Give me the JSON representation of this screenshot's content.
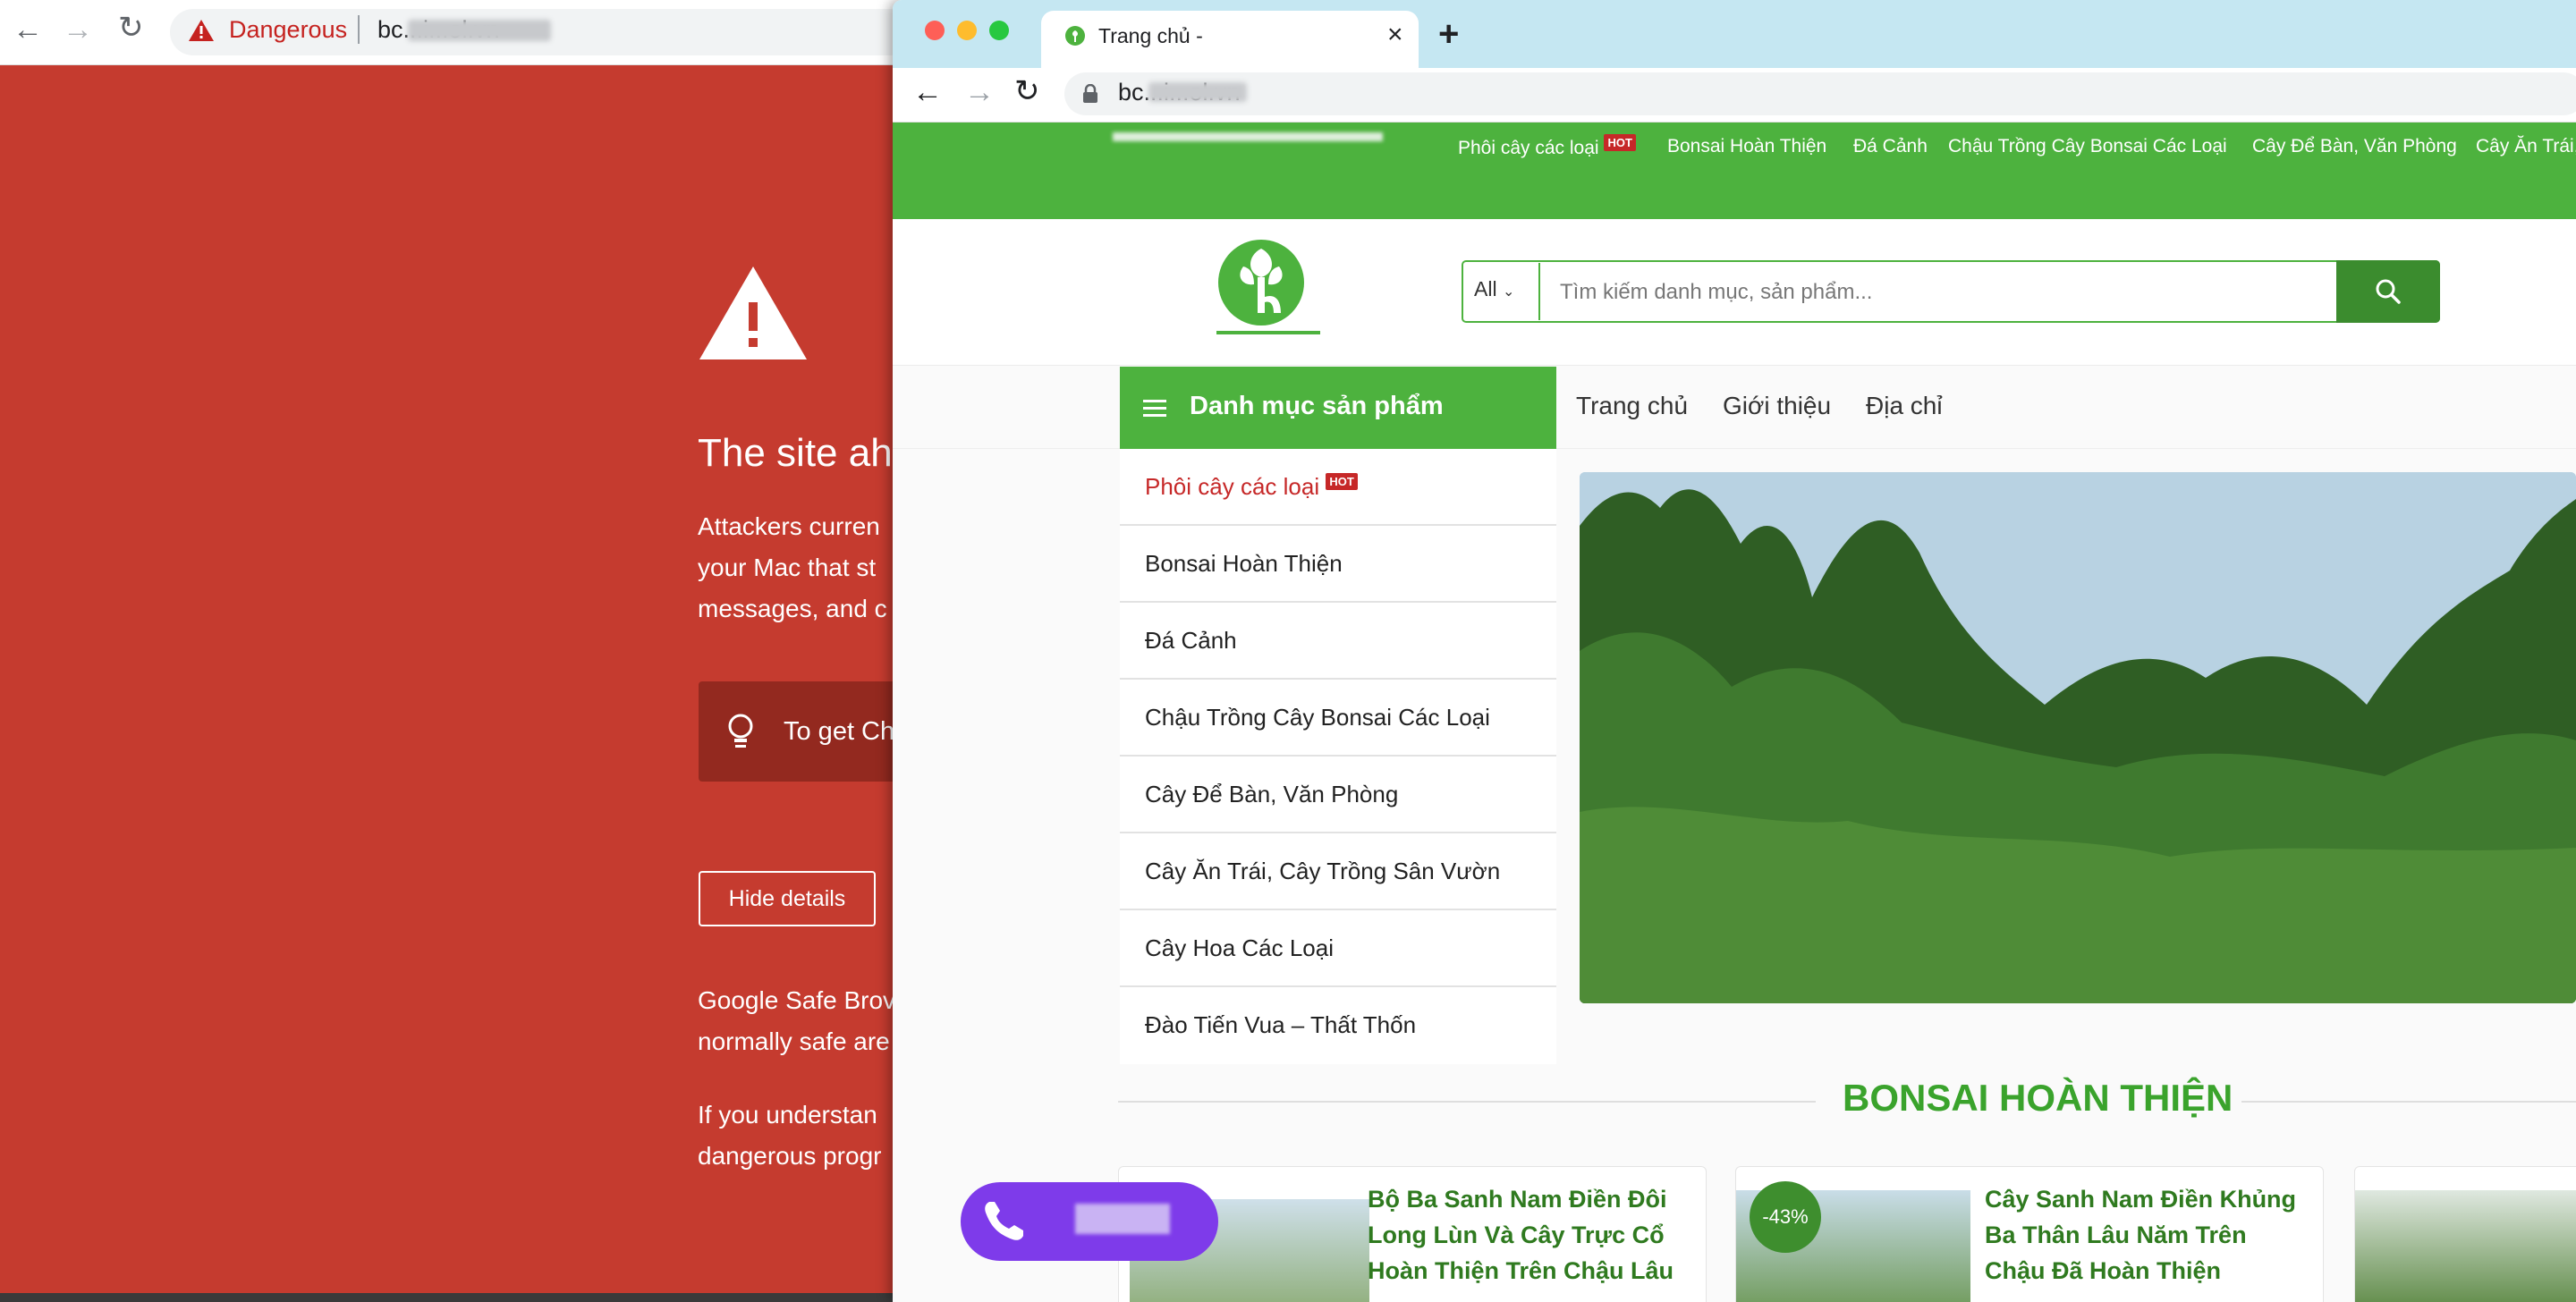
{
  "back_window": {
    "toolbar": {
      "nav_back": "←",
      "nav_forward": "→",
      "reload": "↻",
      "security_label": "Dangerous",
      "url": "bc...i...ol.vn"
    },
    "interstitial": {
      "heading": "The site ah",
      "body_lines": [
        "Attackers curren",
        "your Mac that st",
        "messages, and c"
      ],
      "tip_text": "To get Ch",
      "hide_details_label": "Hide details",
      "safe_browsing_lines": [
        "Google Safe Brov",
        "normally safe are"
      ],
      "understand_lines": [
        "If you understan",
        "dangerous progr"
      ]
    },
    "colors": {
      "danger_bg": "#c53b2f",
      "tip_bg": "#93291f"
    }
  },
  "front_window": {
    "tab": {
      "title": "Trang chủ -",
      "close": "×",
      "new_tab": "+"
    },
    "toolbar": {
      "nav_back": "←",
      "nav_forward": "→",
      "reload": "↻",
      "url": "bc...i...ol.vn"
    },
    "site": {
      "topbar_links": [
        {
          "label": "Phôi cây các loại",
          "badge": "HOT"
        },
        {
          "label": "Bonsai Hoàn Thiện"
        },
        {
          "label": "Đá Cảnh"
        },
        {
          "label": "Chậu Trồng Cây Bonsai Các Loại"
        },
        {
          "label": "Cây Để Bàn, Văn Phòng"
        },
        {
          "label": "Cây Ăn Trái,"
        }
      ],
      "search": {
        "category": "All",
        "placeholder": "Tìm kiếm danh mục, sản phẩm..."
      },
      "category_header": "Danh mục sản phẩm",
      "main_nav": [
        "Trang chủ",
        "Giới thiệu",
        "Địa chỉ"
      ],
      "categories": [
        {
          "label": "Phôi cây các loại",
          "badge": "HOT"
        },
        {
          "label": "Bonsai Hoàn Thiện"
        },
        {
          "label": "Đá Cảnh"
        },
        {
          "label": "Chậu Trồng Cây Bonsai Các Loại"
        },
        {
          "label": "Cây Để Bàn, Văn Phòng"
        },
        {
          "label": "Cây Ăn Trái, Cây Trồng Sân Vườn"
        },
        {
          "label": "Cây Hoa Các Loại"
        },
        {
          "label": "Đào Tiến Vua – Thất Thốn"
        }
      ],
      "section_title": "BONSAI HOÀN THIỆN",
      "products": [
        {
          "title_lines": [
            "Bộ Ba Sanh Nam Điền Đôi",
            "Long Lùn Và Cây Trực Cổ",
            "Hoàn Thiện Trên Chậu Lâu"
          ]
        },
        {
          "title_lines": [
            "Cây Sanh Nam Điền Khủng",
            "Ba Thân Lâu Năm Trên",
            "Chậu Đã Hoàn Thiện"
          ],
          "discount": "-43%"
        }
      ]
    },
    "colors": {
      "brand_green": "#4db23e",
      "dark_green": "#3b8c2e",
      "title_green": "#2f7a1f",
      "hot_red": "#c62828",
      "call_purple": "#7e3bea",
      "tab_bar": "#c5e7f2"
    }
  }
}
